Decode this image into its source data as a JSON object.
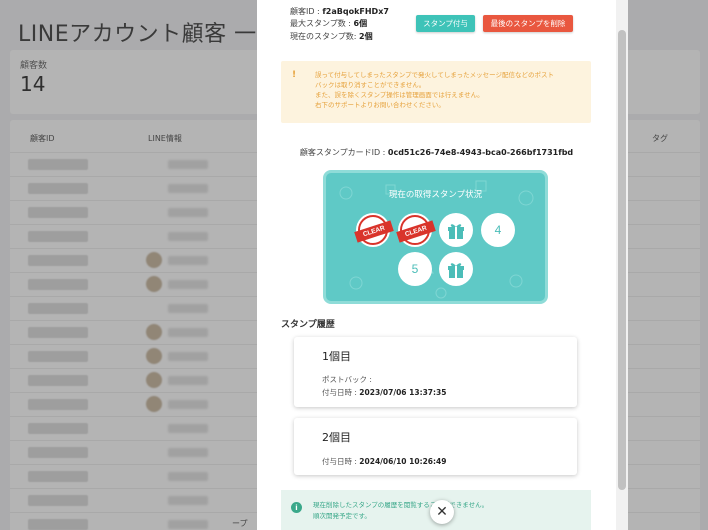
{
  "background": {
    "page_title": "LINEアカウント顧客 一覧",
    "count_label": "顧客数",
    "count_value": "14",
    "table_headers": [
      "顧客ID",
      "LINE情報",
      "タグ"
    ],
    "footer_text": "ープ"
  },
  "modal": {
    "customer_id_label": "顧客ID : ",
    "customer_id": "f2aBqokFHDx7",
    "max_stamps_label": "最大スタンプ数 : ",
    "max_stamps": "6個",
    "current_stamps_label": "現在のスタンプ数: ",
    "current_stamps": "2個",
    "grant_button": "スタンプ付与",
    "delete_button": "最後のスタンプを削除",
    "warning_icon": "!",
    "warning_lines": [
      "誤って付与してしまったスタンプで発火してしまったメッセージ配信などのポスト",
      "バックは取り消すことができません。",
      "また、誤を除くスタンプ操作は管理画面では行えません。",
      "右下のサポートよりお問い合わせください。"
    ],
    "card_id_label": "顧客スタンプカードID : ",
    "card_id": "0cd51c26-74e8-4943-bca0-266bf1731fbd",
    "stamp_card": {
      "title": "現在の取得スタンプ状況",
      "clear_text": "CLEAR",
      "slot_4": "4",
      "slot_5": "5"
    },
    "history_title": "スタンプ履歴",
    "history": [
      {
        "title": "1個目",
        "postback_label": "ポストバック :",
        "date_label": "付与日時 : ",
        "date": "2023/07/06 13:37:35"
      },
      {
        "title": "2個目",
        "date_label": "付与日時 : ",
        "date": "2024/06/10 10:26:49"
      }
    ],
    "info_icon": "i",
    "info_lines": [
      "現在削除したスタンプの履歴を閲覧することができません。",
      "順次開発予定です。"
    ],
    "close_icon": "✕"
  },
  "colors": {
    "teal": "#3ec3b8",
    "red": "#e9573f",
    "warning": "#e6a23c",
    "card_bg": "#5fc9c6"
  }
}
